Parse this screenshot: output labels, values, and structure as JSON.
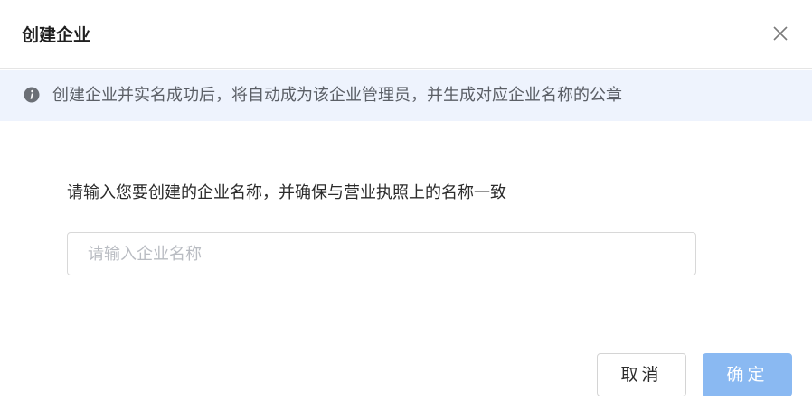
{
  "dialog": {
    "title": "创建企业",
    "close_icon": "close-icon"
  },
  "notice": {
    "icon": "info-icon",
    "text": "创建企业并实名成功后，将自动成为该企业管理员，并生成对应企业名称的公章"
  },
  "form": {
    "prompt": "请输入您要创建的企业名称，并确保与营业执照上的名称一致",
    "name_input": {
      "value": "",
      "placeholder": "请输入企业名称"
    }
  },
  "footer": {
    "cancel_label": "取消",
    "confirm_label": "确定"
  },
  "colors": {
    "notice_bg": "#eef3fd",
    "confirm_disabled": "#8ab9f2",
    "border": "#d8d8d8"
  }
}
